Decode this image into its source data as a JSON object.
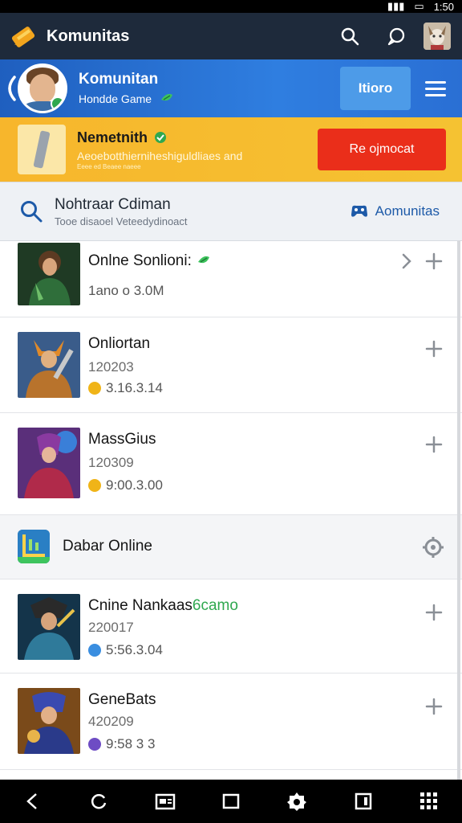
{
  "status_bar": {
    "time": "1:50"
  },
  "app_bar": {
    "title": "Komunitas"
  },
  "profile": {
    "name": "Komunitan",
    "subtitle": "Hondde Game",
    "button_label": "Itioro"
  },
  "promo": {
    "title": "Nemetnith",
    "description": "Aeoebotthierniheshiguldliaes and",
    "fine_print": "Eeee ed Beaee naeee",
    "cta_label": "Re ojmocat"
  },
  "search": {
    "query": "Nohtraar Cdiman",
    "placeholder": "Tooe disaoel Veteedydinoact",
    "link_label": "Aomunitas"
  },
  "games": [
    {
      "title": "Onlne Sonlioni:",
      "verified": true,
      "line2": "",
      "line3": "1ano o 3.0M",
      "coin_color": "",
      "has_chevron": true
    },
    {
      "title": "Onliortan",
      "verified": false,
      "line2": "120203",
      "line3": "3.16.3.14",
      "coin_color": "#f0b418",
      "has_chevron": false
    },
    {
      "title": "MassGius",
      "verified": false,
      "line2": "120309",
      "line3": "9:00.3.00",
      "coin_color": "#f0b418",
      "has_chevron": false
    }
  ],
  "category": {
    "label": "Dabar Online"
  },
  "games_after": [
    {
      "title": "Cnine Nankaas",
      "title_suffix": "6camo",
      "line2": "220017",
      "line3": "5:56.3.04",
      "coin_color": "#3a8ee0"
    },
    {
      "title": "GeneBats",
      "title_suffix": "",
      "line2": "420209",
      "line3": "9:58 3 3",
      "coin_color": "#6e4cc4"
    }
  ]
}
